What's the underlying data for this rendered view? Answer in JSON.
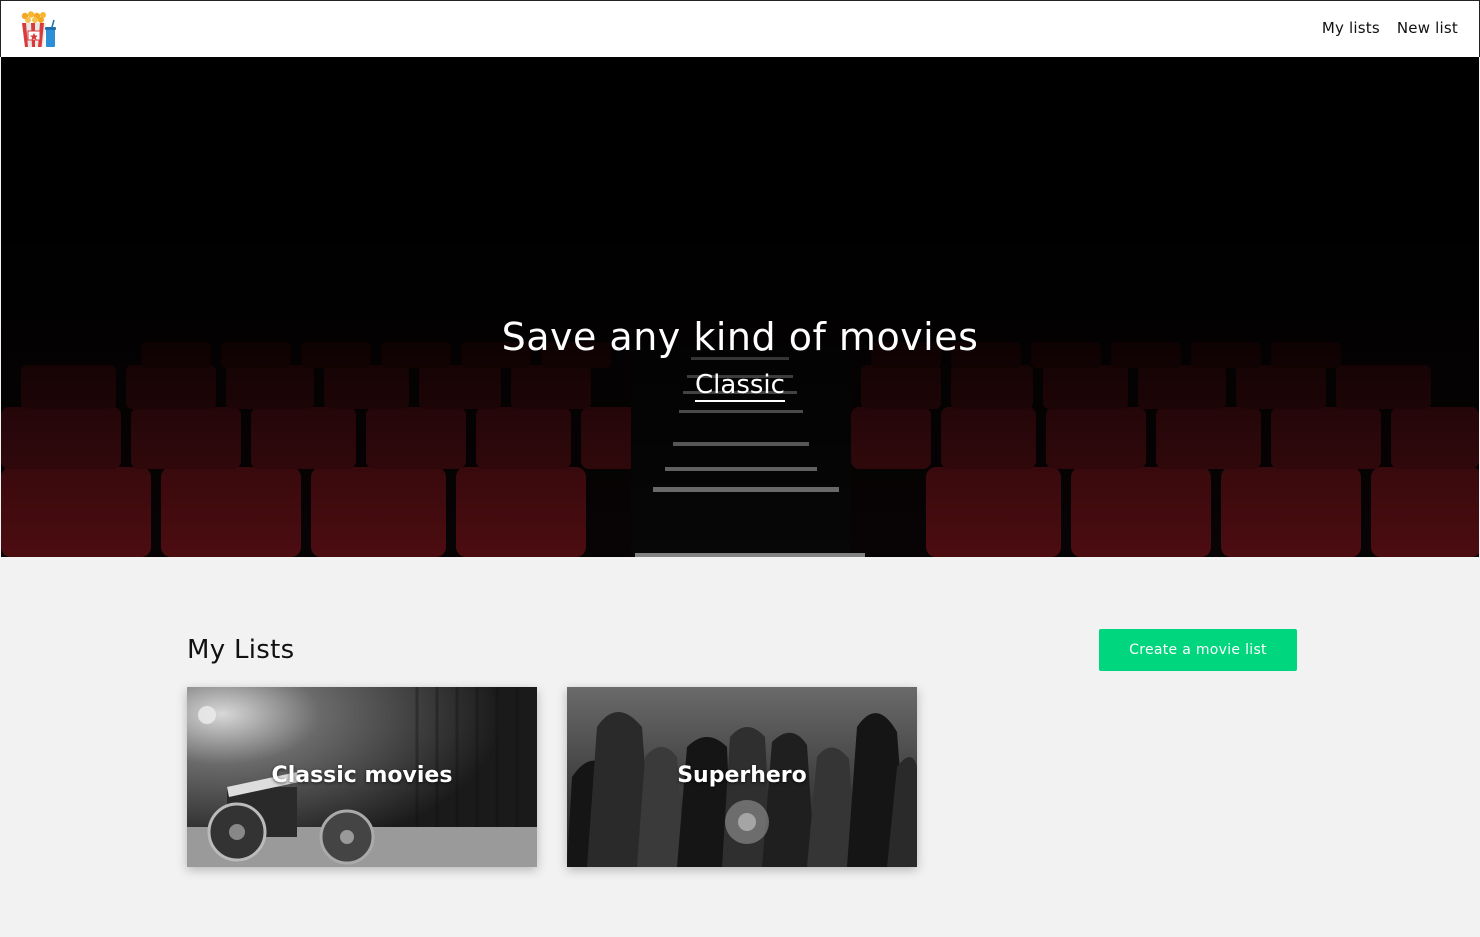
{
  "nav": {
    "logo_icon": "popcorn-cinema-icon",
    "links": [
      {
        "label": "My lists"
      },
      {
        "label": "New list"
      }
    ]
  },
  "hero": {
    "title": "Save any kind of movies",
    "subtitle": "Classic",
    "background": "cinema-seats-image"
  },
  "main": {
    "heading": "My Lists",
    "create_button_label": "Create a movie list",
    "accent_color": "#00d67e",
    "lists": [
      {
        "title": "Classic movies",
        "image": "film-clapperboard-reels-image"
      },
      {
        "title": "Superhero",
        "image": "superhero-group-image"
      }
    ]
  }
}
